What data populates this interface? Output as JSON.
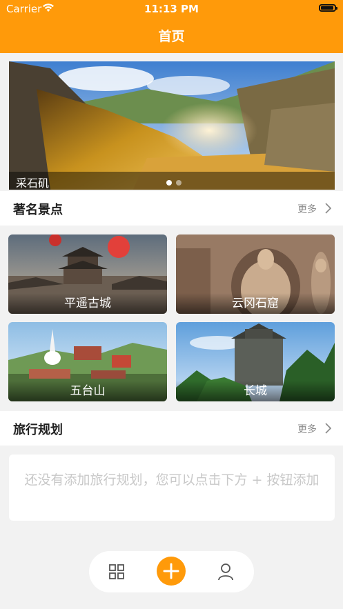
{
  "status_bar": {
    "carrier": "Carrier",
    "time": "11:13 PM"
  },
  "header": {
    "title": "首页"
  },
  "banner": {
    "caption": "采石矶",
    "page_count": 2,
    "active_index": 0
  },
  "famous_spots": {
    "title": "著名景点",
    "more_label": "更多",
    "items": [
      {
        "name": "平遥古城"
      },
      {
        "name": "云冈石窟"
      },
      {
        "name": "五台山"
      },
      {
        "name": "长城"
      }
    ]
  },
  "travel_plans": {
    "title": "旅行规划",
    "more_label": "更多",
    "empty_message": "还没有添加旅行规划，您可以点击下方 + 按钮添加"
  },
  "tabbar": {
    "items": [
      {
        "icon": "grid-icon"
      },
      {
        "icon": "plus-icon"
      },
      {
        "icon": "user-icon"
      }
    ]
  },
  "colors": {
    "accent": "#ff9a0a",
    "background": "#f2f2f2"
  }
}
